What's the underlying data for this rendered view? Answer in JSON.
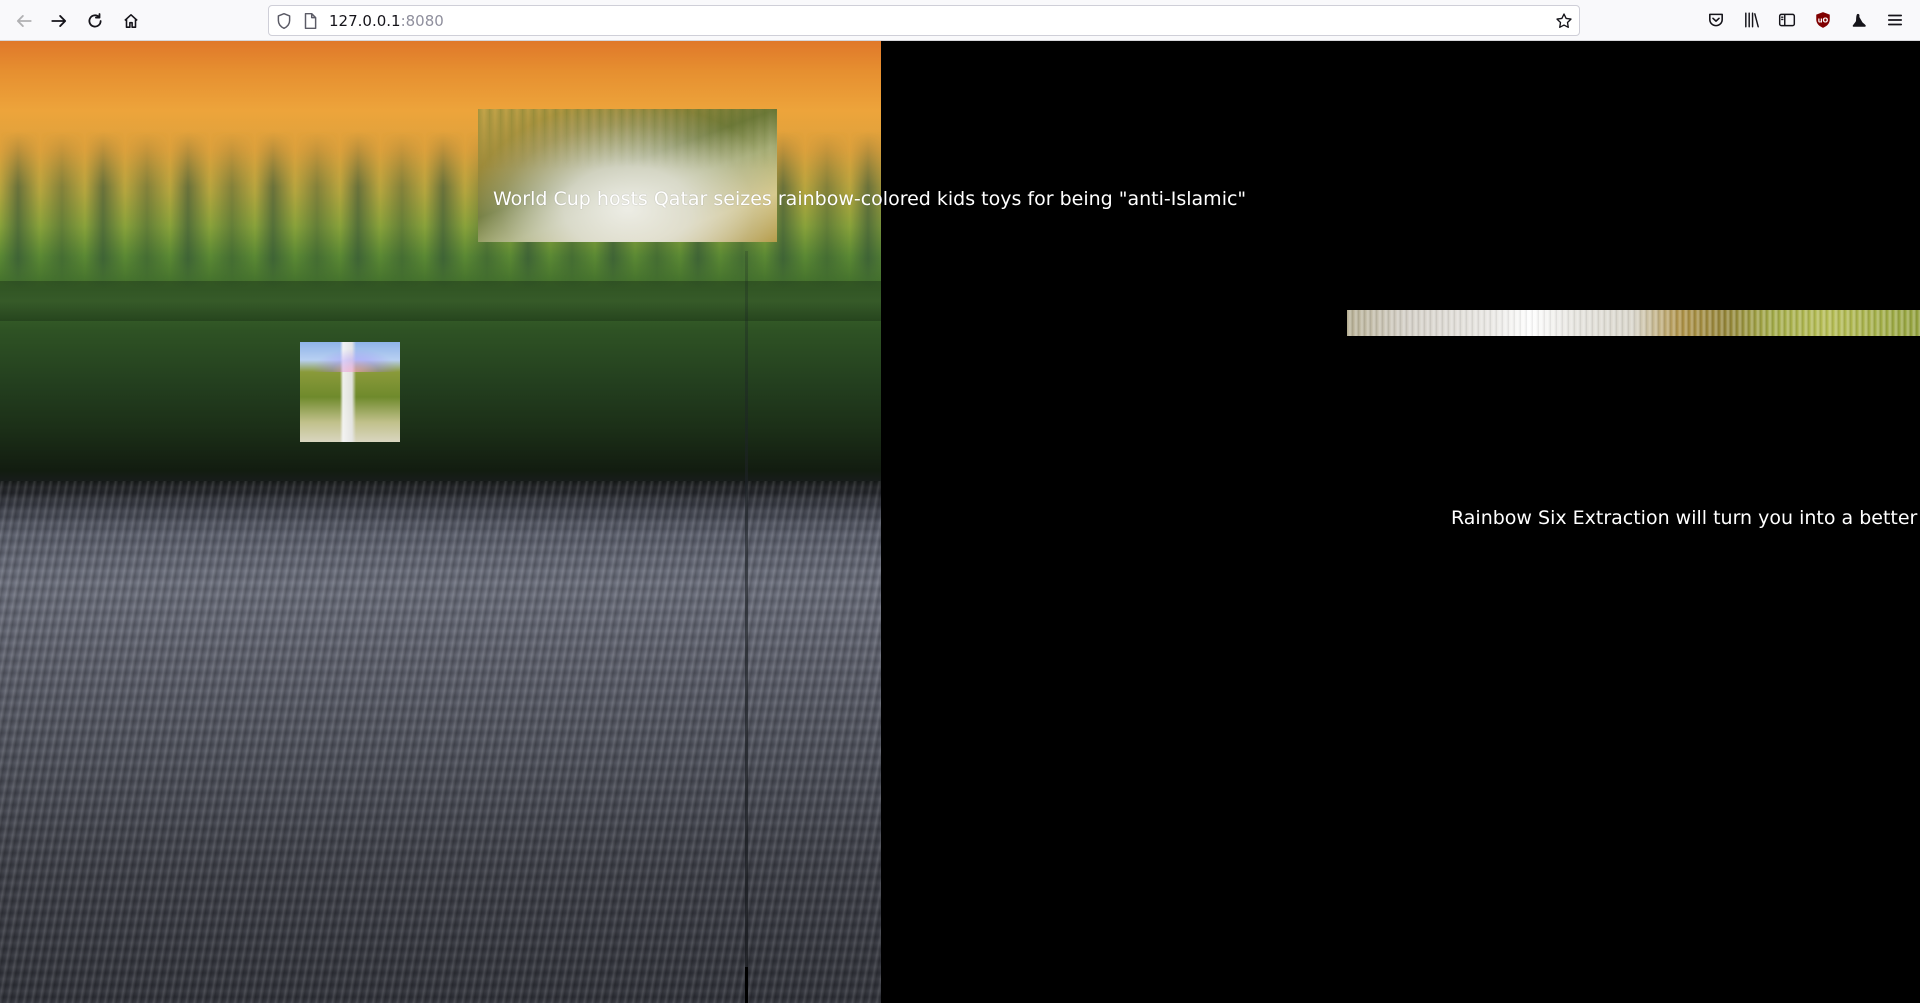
{
  "browser": {
    "url_host": "127.0.0.1",
    "url_port": ":8080",
    "icons": {
      "back": "back-arrow-icon",
      "forward": "forward-arrow-icon",
      "reload": "reload-icon",
      "home": "home-icon",
      "shield": "tracking-protection-shield-icon",
      "page": "page-info-icon",
      "bookmark": "bookmark-star-icon",
      "pocket": "pocket-icon",
      "library": "library-icon",
      "sidebar": "sidebar-icon",
      "ublock": "ublock-origin-icon",
      "extension": "extension-icon",
      "menu": "hamburger-menu-icon"
    }
  },
  "page": {
    "headlines": [
      "World Cup hosts Qatar seizes rainbow-colored kids toys for being \"anti-Islamic\"",
      "Rainbow Six Extraction will turn you into a better"
    ]
  }
}
